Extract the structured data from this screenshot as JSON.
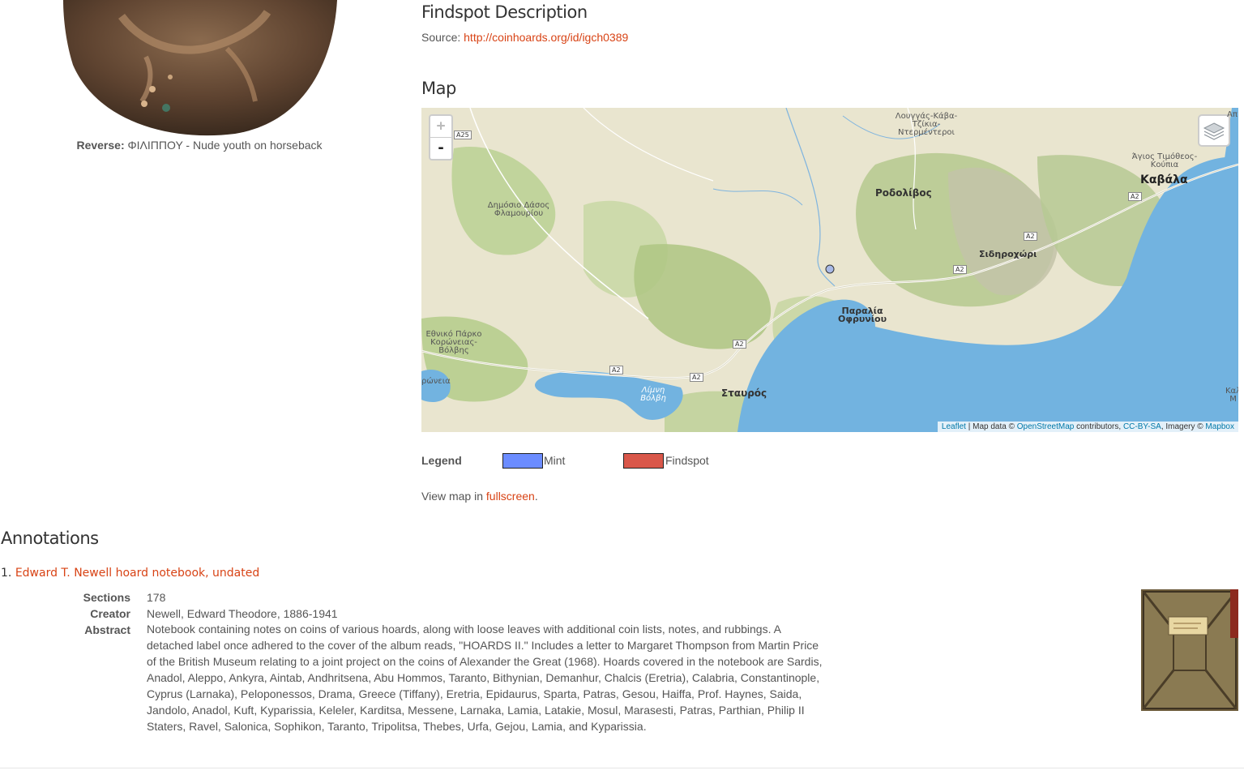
{
  "reverse": {
    "label": "Reverse:",
    "text": "ΦΙΛΙΠΠΟΥ - Nude youth on horseback"
  },
  "findspot": {
    "title": "Findspot Description",
    "source_label": "Source:",
    "source_link": "http://coinhoards.org/id/igch0389"
  },
  "map": {
    "title": "Map",
    "zoom_in": "+",
    "zoom_out": "-",
    "attribution": {
      "leaflet": "Leaflet",
      "sep1": " | Map data © ",
      "osm": "OpenStreetMap",
      "contrib": " contributors, ",
      "license": "CC-BY-SA",
      "imagery": ", Imagery © ",
      "mapbox": "Mapbox"
    },
    "places": {
      "lougkas": "Λουγγάς-Κάβα-\nΤζίκια-\nΝτερμέντεροι",
      "dasos": "Δημόσιο Δάσος\nΦλαμουρίου",
      "rodolivos": "Ροδολίβος",
      "agios": "Άγιος Τιμόθεος-\nΚούπια",
      "kavala": "Καβάλα",
      "sidirochori": "Σιδηροχώρι",
      "paralia": "Παραλία\nΟφρυνίου",
      "koroneia": "Εθνικό Πάρκο\nΚορώνειας-\nΒόλβης",
      "korwneia": "ρώνεια",
      "limni": "Λίμνη\nΒόλβη",
      "stavros": "Σταυρός",
      "kala": "Καλ\nΜ",
      "api": "Απ"
    },
    "roads": {
      "a25": "A25",
      "a2": "A2"
    }
  },
  "legend": {
    "label": "Legend",
    "mint": "Mint",
    "findspot": "Findspot",
    "mint_color": "#6b8cff",
    "findspot_color": "#d9574a"
  },
  "view_map": {
    "prefix": "View map in ",
    "link": "fullscreen",
    "suffix": "."
  },
  "annotations": {
    "title": "Annotations",
    "items": [
      {
        "number": "1.",
        "title": "Edward T. Newell hoard notebook, undated",
        "sections_label": "Sections",
        "sections": "178",
        "creator_label": "Creator",
        "creator": "Newell, Edward Theodore, 1886-1941",
        "abstract_label": "Abstract",
        "abstract": "Notebook containing notes on coins of various hoards, along with loose leaves with additional coin lists, notes, and rubbings. A detached label once adhered to the cover of the album reads, \"HOARDS II.\" Includes a letter to Margaret Thompson from Martin Price of the British Museum relating to a joint project on the coins of Alexander the Great (1968). Hoards covered in the notebook are Sardis, Anadol, Aleppo, Ankyra, Aintab, Andhritsena, Abu Hommos, Taranto, Bithynian, Demanhur, Chalcis (Eretria), Calabria, Constantinople, Cyprus (Larnaka), Peloponessos, Drama, Greece (Tiffany), Eretria, Epidaurus, Sparta, Patras, Gesou, Haiffa, Prof. Haynes, Saida, Jandolo, Anadol, Kuft, Kyparissia, Keleler, Karditsa, Messene, Larnaka, Lamia, Latakie, Mosul, Marasesti, Patras, Parthian, Philip II Staters, Ravel, Salonica, Sophikon, Taranto, Tripolitsa, Thebes, Urfa, Gejou, Lamia, and Kyparissia."
      }
    ]
  }
}
